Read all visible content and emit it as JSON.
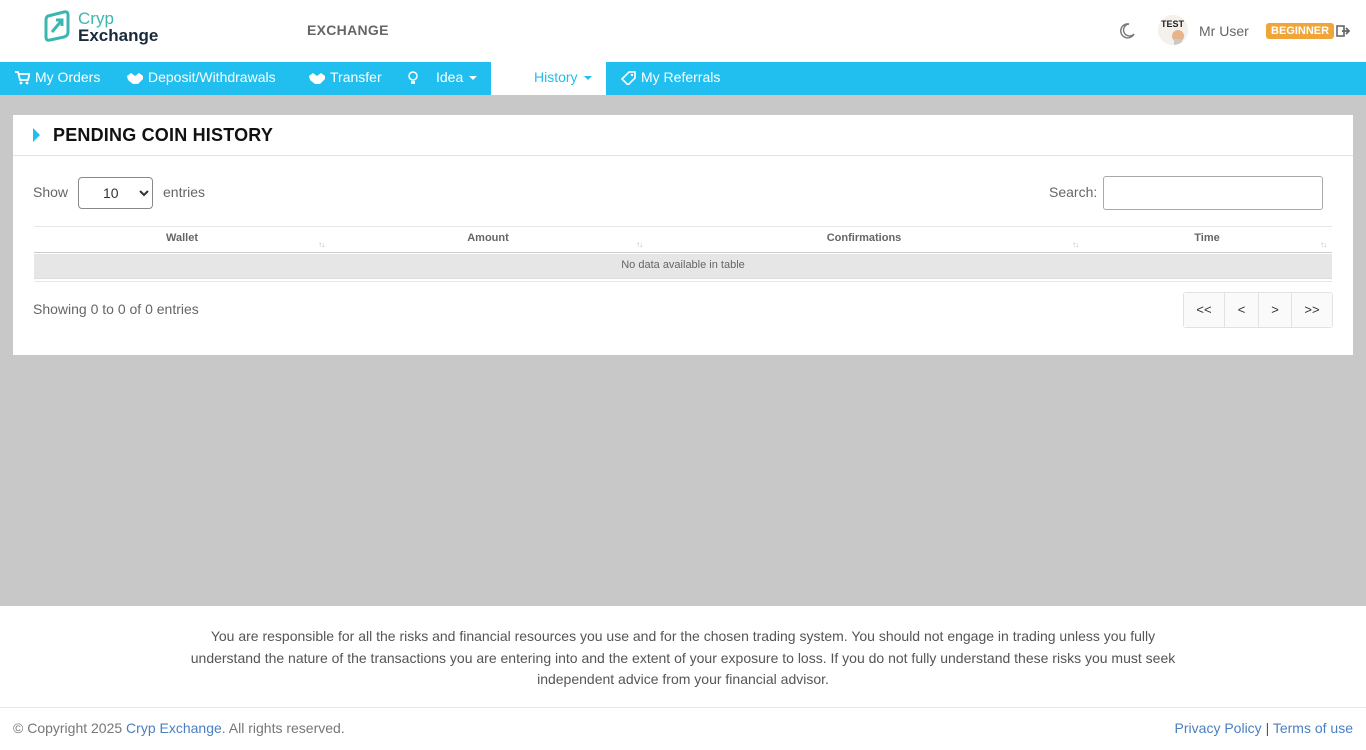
{
  "header": {
    "logo_line1": "Cryp",
    "logo_line2": "Exchange",
    "exchange_link": "EXCHANGE",
    "username": "Mr User",
    "badge": "BEGINNER",
    "badge_color": "#f0a53a"
  },
  "nav": {
    "accent": "#20bff0",
    "items": [
      {
        "label": "My Orders",
        "icon": "cart-icon"
      },
      {
        "label": "Deposit/Withdrawals",
        "icon": "handshake-icon"
      },
      {
        "label": "Transfer",
        "icon": "handshake-icon"
      },
      {
        "label": "Idea",
        "icon": "lightbulb-icon"
      },
      {
        "label": "History",
        "icon": "none"
      },
      {
        "label": "My Referrals",
        "icon": "ticket-icon"
      }
    ],
    "active": "History"
  },
  "card": {
    "title": "PENDING COIN HISTORY",
    "show_label": "Show",
    "entries_value": "10",
    "entries_label": "entries",
    "search_label": "Search:",
    "search_value": "",
    "columns": [
      "Wallet",
      "Amount",
      "Confirmations",
      "Time"
    ],
    "empty_message": "No data available in table",
    "info": "Showing 0 to 0 of 0 entries",
    "pager": [
      "<<",
      "<",
      ">",
      ">>"
    ]
  },
  "footer": {
    "disclaimer": "You are responsible for all the risks and financial resources you use and for the chosen trading system. You should not engage in trading unless you fully understand the nature of the transactions you are entering into and the extent of your exposure to loss. If you do not fully understand these risks you must seek independent advice from your financial advisor.",
    "copyright_prefix": "© Copyright 2025 ",
    "copyright_brand": "Cryp Exchange",
    "copyright_suffix": ". All rights reserved.",
    "privacy": "Privacy Policy",
    "separator": " | ",
    "terms": "Terms of use"
  }
}
